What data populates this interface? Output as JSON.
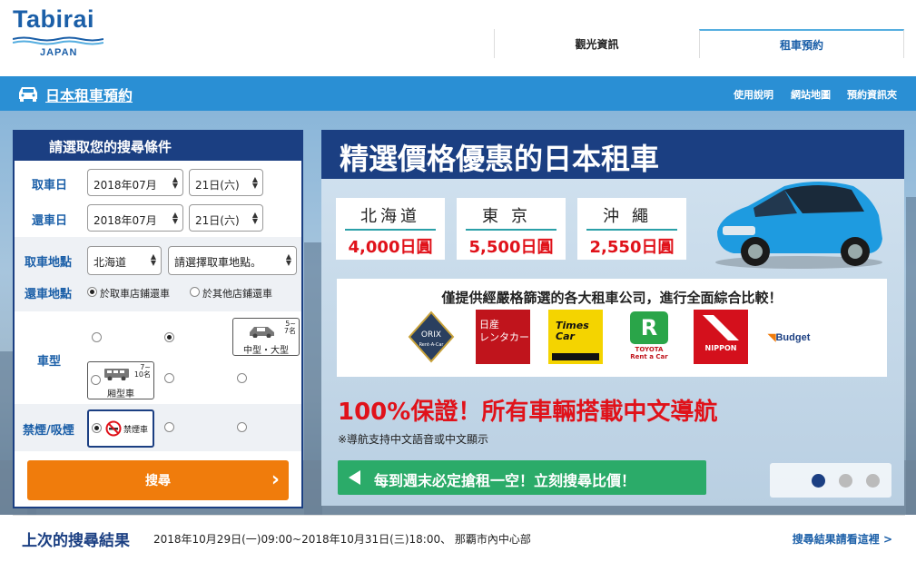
{
  "header": {
    "logo_text": "Tabirai",
    "logo_sub": "JAPAN",
    "tabs": [
      {
        "label": "觀光資訊"
      },
      {
        "label": "租車預約"
      }
    ]
  },
  "bluebar": {
    "title": "日本租車預約",
    "links": [
      "使用說明",
      "網站地圖",
      "預約資訊夾"
    ]
  },
  "search_panel": {
    "title": "請選取您的搜尋條件",
    "pickup_date_label": "取車日",
    "return_date_label": "還車日",
    "pickup_month": "2018年07月",
    "pickup_day": "21日(六)",
    "return_month": "2018年07月",
    "return_day": "21日(六)",
    "pickup_place_label": "取車地點",
    "region_value": "北海道",
    "store_placeholder": "請選擇取車地點。",
    "return_place_label": "還車地點",
    "return_opt_same": "於取車店鋪還車",
    "return_opt_other": "於其他店鋪還車",
    "car_type_label": "車型",
    "car_mid": {
      "capacity": "5~\n7名",
      "name": "中型・大型"
    },
    "car_van": {
      "capacity": "7~\n10名",
      "name": "厢型車"
    },
    "smoking_label": "禁煙/吸煙",
    "non_smoking_text": "禁煙車",
    "search_button": "搜尋",
    "search_arrow": "›"
  },
  "banner": {
    "title": "精選價格優惠的日本租車",
    "prices": [
      {
        "region": "北海道",
        "price": "4,000日圓"
      },
      {
        "region": "東京",
        "price": "5,500日圓"
      },
      {
        "region": "沖繩",
        "price": "2,550日圓"
      }
    ],
    "compare_text": "僅提供經嚴格篩選的各大租車公司，進行全面綜合比較！",
    "companies": [
      "ORIX Rent-A-Car",
      "日産レンタカー",
      "Times Car RENTAL",
      "TOYOTA Rent a Car",
      "NIPPON Rent-A-Car",
      "Budget"
    ],
    "guarantee": "100%保證！所有車輛搭載中文導航",
    "note": "※導航支持中文語音或中文顯示",
    "cta": "每到週末必定搶租一空！立刻搜尋比價！",
    "carousel_active": 0,
    "carousel_count": 3
  },
  "footer": {
    "title": "上次的搜尋結果",
    "detail": "2018年10月29日(一)09:00~2018年10月31日(三)18:00、 那覇市內中心部",
    "link": "搜尋結果請看這裡 >"
  },
  "colors": {
    "brand_blue": "#1b5fa8",
    "navy": "#1b3f82",
    "orange": "#f07c0c",
    "red": "#e0121a",
    "green": "#2bab69"
  }
}
